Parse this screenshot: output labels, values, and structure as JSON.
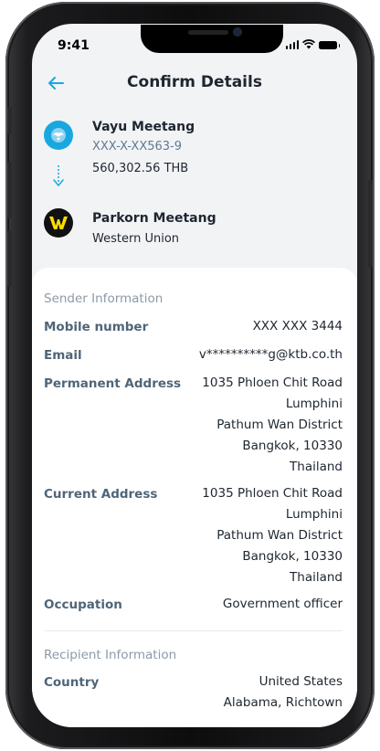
{
  "status_bar": {
    "time": "9:41"
  },
  "header": {
    "title": "Confirm Details"
  },
  "sender": {
    "name": "Vayu Meetang",
    "account": "XXX-X-XX563-9",
    "amount": "560,302.56 THB"
  },
  "recipient": {
    "name": "Parkorn Meetang",
    "provider": "Western Union"
  },
  "sender_info": {
    "section_title": "Sender Information",
    "mobile_label": "Mobile number",
    "mobile_value": "XXX XXX 3444",
    "email_label": "Email",
    "email_value": "v**********g@ktb.co.th",
    "permanent_label": "Permanent Address",
    "permanent_lines": [
      "1035 Phloen Chit Road",
      "Lumphini",
      "Pathum Wan District",
      "Bangkok, 10330",
      "Thailand"
    ],
    "current_label": "Current Address",
    "current_lines": [
      "1035 Phloen Chit Road",
      "Lumphini",
      "Pathum Wan District",
      "Bangkok, 10330",
      "Thailand"
    ],
    "occupation_label": "Occupation",
    "occupation_value": "Government officer"
  },
  "recipient_info": {
    "section_title": "Recipient Information",
    "country_label": "Country",
    "country_lines": [
      "United States",
      "Alabama, Richtown"
    ]
  },
  "colors": {
    "accent": "#19a7e0",
    "text": "#1e2630",
    "label": "#4f6578",
    "section": "#8c9aa8"
  },
  "icons": {
    "back": "arrow-left-icon",
    "sender": "ktb-bank-logo",
    "recipient": "western-union-logo",
    "flow": "arrow-down-icon"
  }
}
